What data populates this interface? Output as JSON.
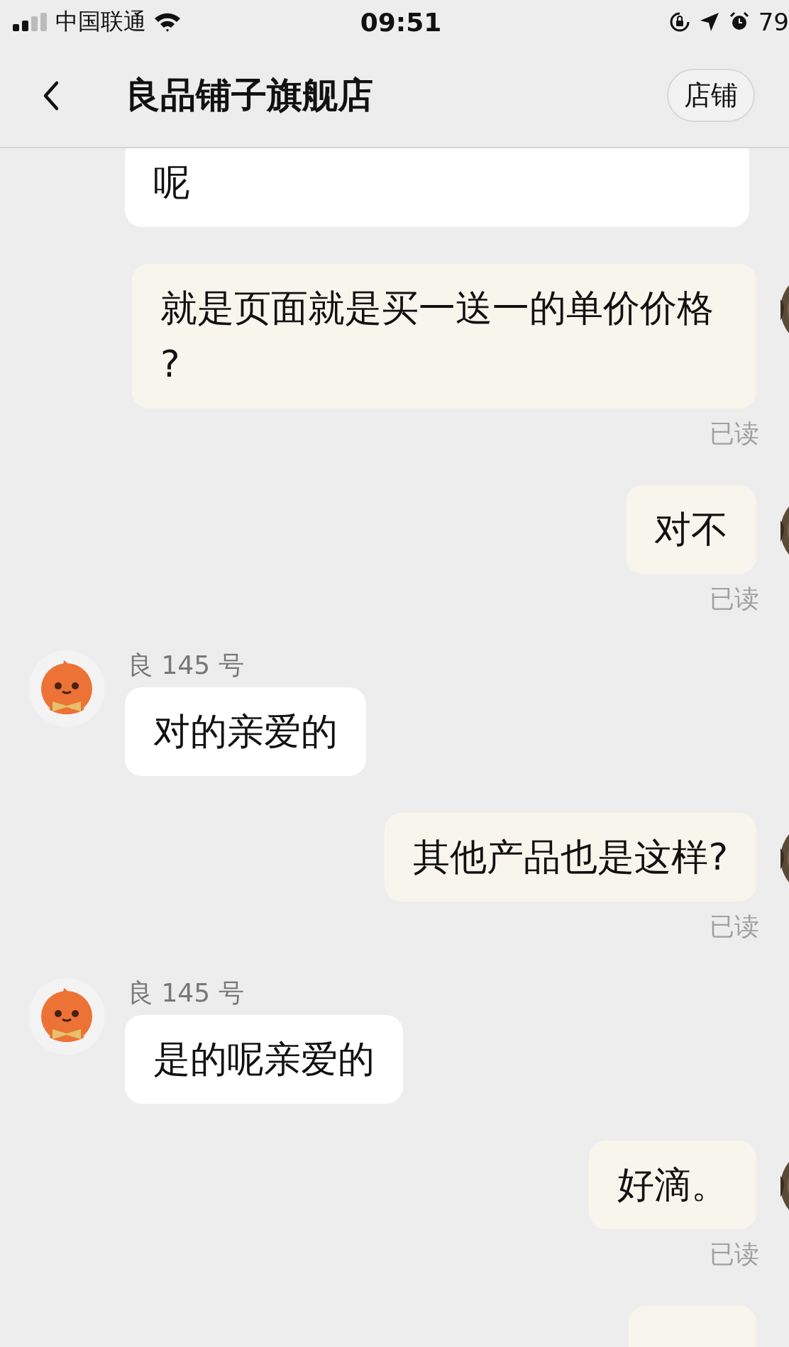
{
  "status_bar": {
    "carrier": "中国联通",
    "time": "09:51",
    "battery": "79"
  },
  "nav": {
    "title": "良品铺子旗舰店",
    "shop_button": "店铺"
  },
  "messages": [
    {
      "kind": "incoming",
      "text": "呢"
    },
    {
      "kind": "outgoing",
      "text": "就是页面就是买一送一的单价价格?",
      "receipt": "已读"
    },
    {
      "kind": "outgoing",
      "text": "对不",
      "receipt": "已读"
    },
    {
      "kind": "incoming",
      "sender": "良 145 号",
      "text": "对的亲爱的"
    },
    {
      "kind": "outgoing",
      "text": "其他产品也是这样?",
      "receipt": "已读"
    },
    {
      "kind": "incoming",
      "sender": "良 145 号",
      "text": "是的呢亲爱的"
    },
    {
      "kind": "outgoing",
      "text": "好滴。",
      "receipt": "已读"
    },
    {
      "kind": "outgoing"
    }
  ]
}
